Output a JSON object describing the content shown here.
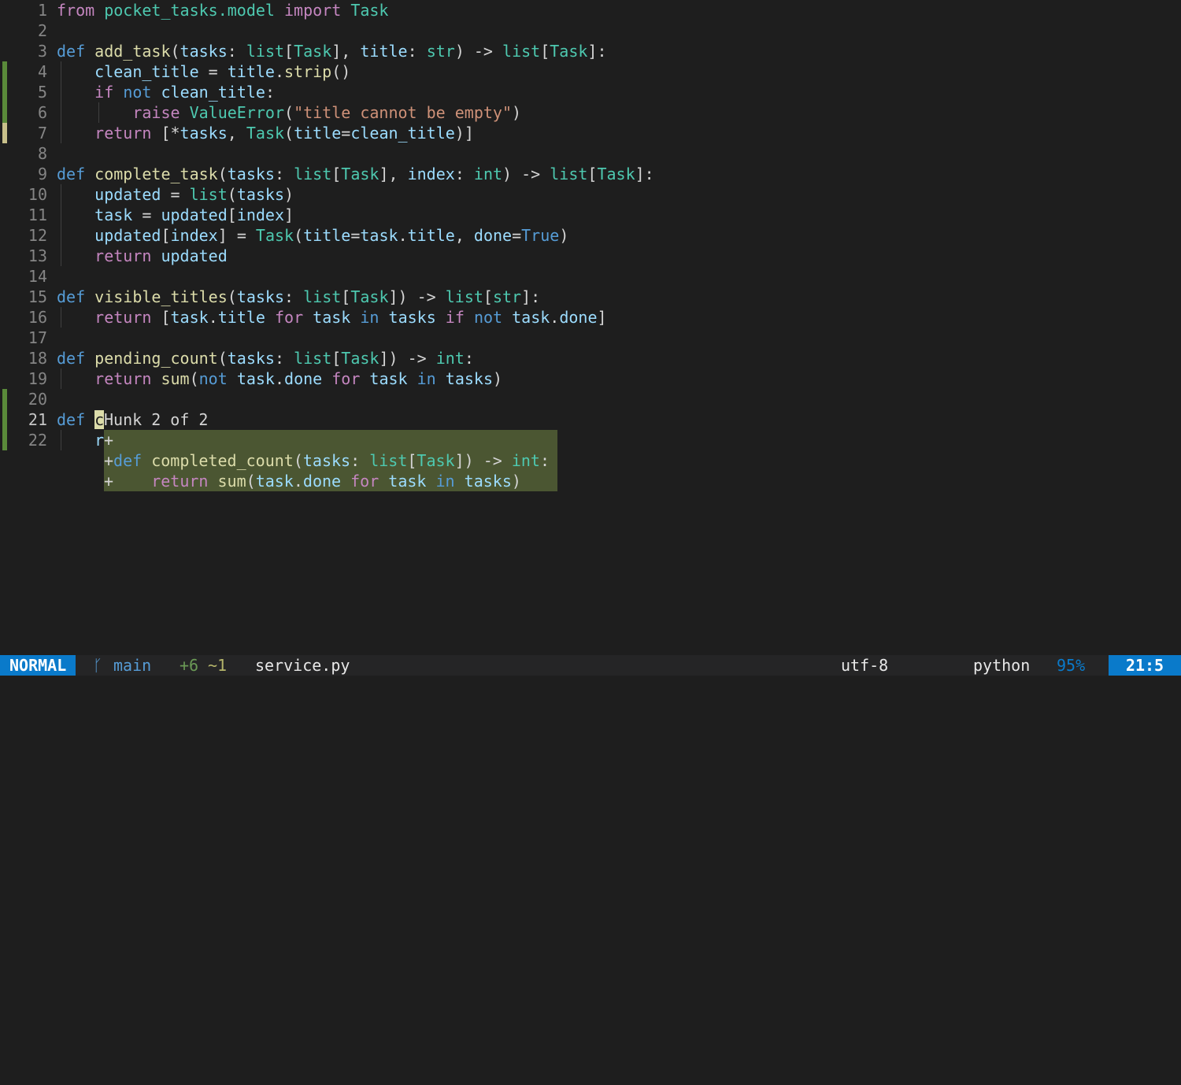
{
  "editor": {
    "lines": [
      {
        "n": "1",
        "html": "<span class='kw2'>from</span> <span class='ty'>pocket_tasks.model</span> <span class='kw2'>import</span> <span class='ty'>Task</span>"
      },
      {
        "n": "2",
        "html": ""
      },
      {
        "n": "3",
        "html": "<span class='kw'>def</span> <span class='fn'>add_task</span>(<span class='var'>tasks</span>: <span class='ty'>list</span>[<span class='ty'>Task</span>], <span class='var'>title</span>: <span class='ty'>str</span>) -&gt; <span class='ty'>list</span>[<span class='ty'>Task</span>]:"
      },
      {
        "n": "4",
        "html": "    <span class='var'>clean_title</span> = <span class='var'>title</span>.<span class='fn'>strip</span>()"
      },
      {
        "n": "5",
        "html": "    <span class='kw2'>if</span> <span class='kw'>not</span> <span class='var'>clean_title</span>:"
      },
      {
        "n": "6",
        "html": "        <span class='kw2'>raise</span> <span class='ty'>ValueError</span>(<span class='str'>\"title cannot be empty\"</span>)"
      },
      {
        "n": "7",
        "html": "    <span class='kw2'>return</span> [*<span class='var'>tasks</span>, <span class='ty'>Task</span>(<span class='var'>title</span>=<span class='var'>clean_title</span>)]"
      },
      {
        "n": "8",
        "html": ""
      },
      {
        "n": "9",
        "html": "<span class='kw'>def</span> <span class='fn'>complete_task</span>(<span class='var'>tasks</span>: <span class='ty'>list</span>[<span class='ty'>Task</span>], <span class='var'>index</span>: <span class='ty'>int</span>) -&gt; <span class='ty'>list</span>[<span class='ty'>Task</span>]:"
      },
      {
        "n": "10",
        "html": "    <span class='var'>updated</span> = <span class='ty'>list</span>(<span class='var'>tasks</span>)"
      },
      {
        "n": "11",
        "html": "    <span class='var'>task</span> = <span class='var'>updated</span>[<span class='var'>index</span>]"
      },
      {
        "n": "12",
        "html": "    <span class='var'>updated</span>[<span class='var'>index</span>] = <span class='ty'>Task</span>(<span class='var'>title</span>=<span class='var'>task</span>.<span class='var'>title</span>, <span class='var'>done</span>=<span class='kw'>True</span>)"
      },
      {
        "n": "13",
        "html": "    <span class='kw2'>return</span> <span class='var'>updated</span>"
      },
      {
        "n": "14",
        "html": ""
      },
      {
        "n": "15",
        "html": "<span class='kw'>def</span> <span class='fn'>visible_titles</span>(<span class='var'>tasks</span>: <span class='ty'>list</span>[<span class='ty'>Task</span>]) -&gt; <span class='ty'>list</span>[<span class='ty'>str</span>]:"
      },
      {
        "n": "16",
        "html": "    <span class='kw2'>return</span> [<span class='var'>task</span>.<span class='var'>title</span> <span class='kw2'>for</span> <span class='var'>task</span> <span class='kw'>in</span> <span class='var'>tasks</span> <span class='kw2'>if</span> <span class='kw'>not</span> <span class='var'>task</span>.<span class='var'>done</span>]"
      },
      {
        "n": "17",
        "html": ""
      },
      {
        "n": "18",
        "html": "<span class='kw'>def</span> <span class='fn'>pending_count</span>(<span class='var'>tasks</span>: <span class='ty'>list</span>[<span class='ty'>Task</span>]) -&gt; <span class='ty'>int</span>:"
      },
      {
        "n": "19",
        "html": "    <span class='kw2'>return</span> <span class='fn'>sum</span>(<span class='kw'>not</span> <span class='var'>task</span>.<span class='var'>done</span> <span class='kw2'>for</span> <span class='var'>task</span> <span class='kw'>in</span> <span class='var'>tasks</span>)"
      },
      {
        "n": "20",
        "html": ""
      },
      {
        "n": "21",
        "html": "<span class='kw'>def</span> <span class='cursor'>c</span>"
      },
      {
        "n": "22",
        "html": "    <span class='var'>r</span>"
      }
    ]
  },
  "hunk_popup": {
    "title": "Hunk 2 of 2",
    "lines": [
      "<span>+</span>",
      "<span>+</span><span class='kw'>def</span> <span class='fn'>completed_count</span>(<span class='var'>tasks</span>: <span class='ty'>list</span>[<span class='ty'>Task</span>]) -&gt; <span class='ty'>int</span>:",
      "<span>+</span>    <span class='kw2'>return</span> <span class='fn'>sum</span>(<span class='var'>task</span>.<span class='var'>done</span> <span class='kw2'>for</span> <span class='var'>task</span> <span class='kw'>in</span> <span class='var'>tasks</span>)"
    ]
  },
  "statusbar": {
    "mode": "NORMAL",
    "branch_icon": "git-branch-icon",
    "branch": "main",
    "diff_added": "+6",
    "diff_modified": "~1",
    "filename": "service.py",
    "encoding": "utf-8",
    "os_icon": "linux-icon",
    "filetype_icon": "python-icon",
    "filetype": "python",
    "percent": "95%",
    "position": "21:5"
  }
}
